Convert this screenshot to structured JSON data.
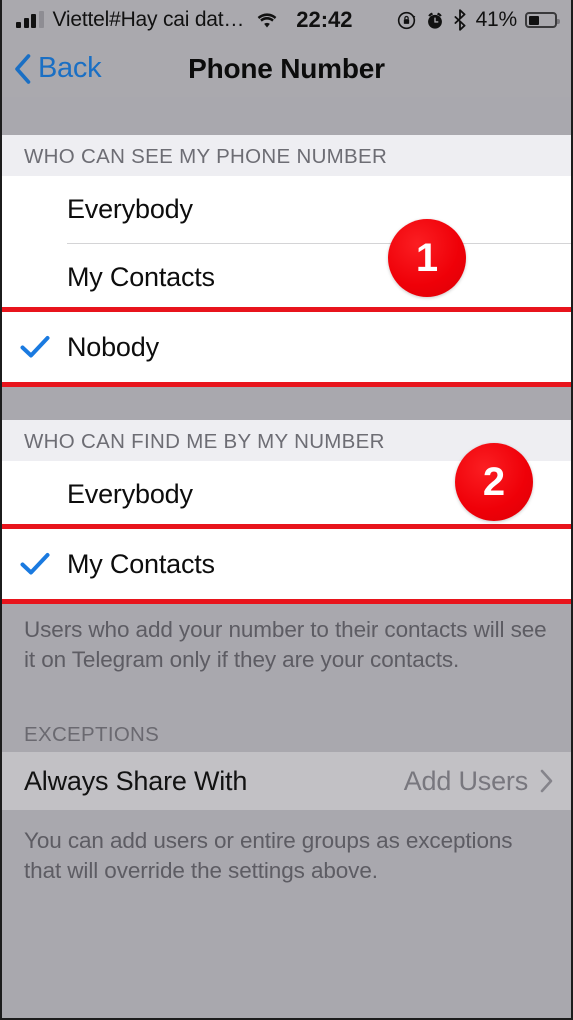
{
  "status_bar": {
    "carrier": "Viettel#Hay cai dat…",
    "time": "22:42",
    "battery_percent": "41%",
    "icons": [
      "signal-bars-icon",
      "wifi-icon",
      "rotation-lock-icon",
      "alarm-clock-icon",
      "bluetooth-icon",
      "battery-icon"
    ]
  },
  "nav": {
    "back_label": "Back",
    "title": "Phone Number"
  },
  "sections": [
    {
      "header": "WHO CAN SEE MY PHONE NUMBER",
      "options": [
        {
          "label": "Everybody",
          "checked": false,
          "highlighted": false
        },
        {
          "label": "My Contacts",
          "checked": false,
          "highlighted": false
        },
        {
          "label": "Nobody",
          "checked": true,
          "highlighted": true
        }
      ]
    },
    {
      "header": "WHO CAN FIND ME BY MY NUMBER",
      "options": [
        {
          "label": "Everybody",
          "checked": false,
          "highlighted": false
        },
        {
          "label": "My Contacts",
          "checked": true,
          "highlighted": true
        }
      ],
      "footer": "Users who add your number to their contacts will see it on Telegram only if they are your contacts."
    }
  ],
  "exceptions": {
    "header": "EXCEPTIONS",
    "row": {
      "label": "Always Share With",
      "value": "Add Users"
    },
    "footer": "You can add users or entire groups as exceptions that will override the settings above."
  },
  "badges": [
    {
      "number": "1"
    },
    {
      "number": "2"
    }
  ],
  "colors": {
    "accent_blue": "#1a6fc4",
    "check_blue": "#1a7ae0",
    "badge_red": "#ef0008",
    "highlight_red": "#e8141c",
    "page_gray": "#a9a8ae",
    "row_white": "#ffffff",
    "section_header_bg": "#eeeef2"
  }
}
